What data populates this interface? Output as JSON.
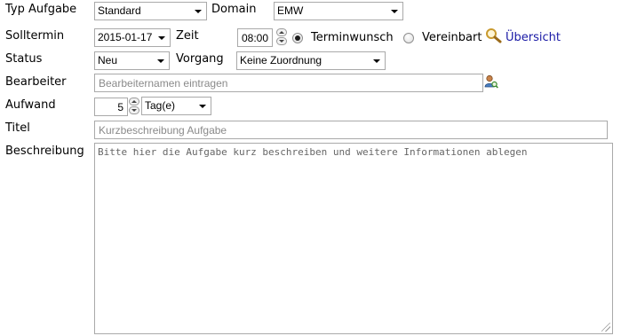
{
  "form": {
    "typ_aufgabe": {
      "label": "Typ Aufgabe",
      "selected": "Standard"
    },
    "domain": {
      "label": "Domain",
      "selected": "EMW"
    },
    "solltermin": {
      "label": "Solltermin",
      "date": "2015-01-17"
    },
    "zeit": {
      "label": "Zeit",
      "value": "08:00"
    },
    "terminwunsch": {
      "label": "Terminwunsch",
      "checked": true
    },
    "vereinbart": {
      "label": "Vereinbart",
      "checked": false
    },
    "uebersicht": {
      "label": "Übersicht",
      "icon": "magnifier-icon"
    },
    "status": {
      "label": "Status",
      "selected": "Neu"
    },
    "vorgang": {
      "label": "Vorgang",
      "selected": "Keine Zuordnung"
    },
    "bearbeiter": {
      "label": "Bearbeiter",
      "placeholder": "Bearbeiternamen eintragen",
      "value": "",
      "icon": "user-search-icon"
    },
    "aufwand": {
      "label": "Aufwand",
      "value": "5",
      "unit": "Tag(e)"
    },
    "titel": {
      "label": "Titel",
      "placeholder": "Kurzbeschreibung Aufgabe",
      "value": ""
    },
    "beschreibung": {
      "label": "Beschreibung",
      "placeholder": "Bitte hier die Aufgabe kurz beschreiben und weitere Informationen ablegen",
      "value": ""
    }
  }
}
